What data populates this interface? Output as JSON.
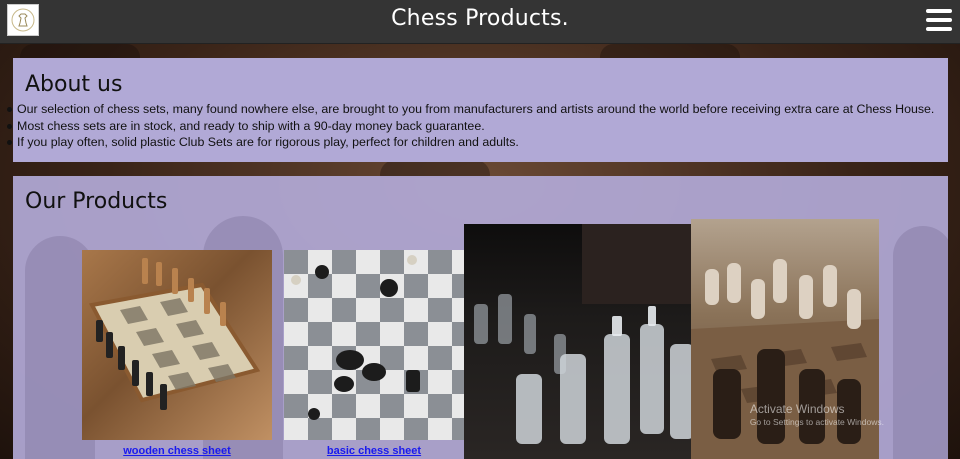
{
  "header": {
    "title": "Chess Products.",
    "logo_icon": "chess-logo-icon",
    "menu_icon": "hamburger-menu-icon"
  },
  "about": {
    "heading": "About us",
    "items": [
      "Our selection of chess sets, many found nowhere else, are brought to you from manufacturers and artists around the world before receiving extra care at Chess House.",
      "Most chess sets are in stock, and ready to ship with a 90-day money back guarantee.",
      "If you play often, solid plastic Club Sets are for rigorous play, perfect for children and adults."
    ]
  },
  "products": {
    "heading": "Our Products",
    "items": [
      {
        "caption": "wooden chess sheet",
        "image": "wooden-chess-set-image"
      },
      {
        "caption": "basic chess sheet",
        "image": "basic-chess-board-image"
      },
      {
        "caption": "",
        "image": "glass-chess-pieces-image"
      },
      {
        "caption": "",
        "image": "carved-stone-chess-image"
      }
    ]
  },
  "watermark": {
    "line1": "Activate Windows",
    "line2": "Go to Settings to activate Windows."
  },
  "colors": {
    "header_bg": "#343434",
    "panel_bg": "#b1a9d6",
    "link": "#1a1aee"
  }
}
